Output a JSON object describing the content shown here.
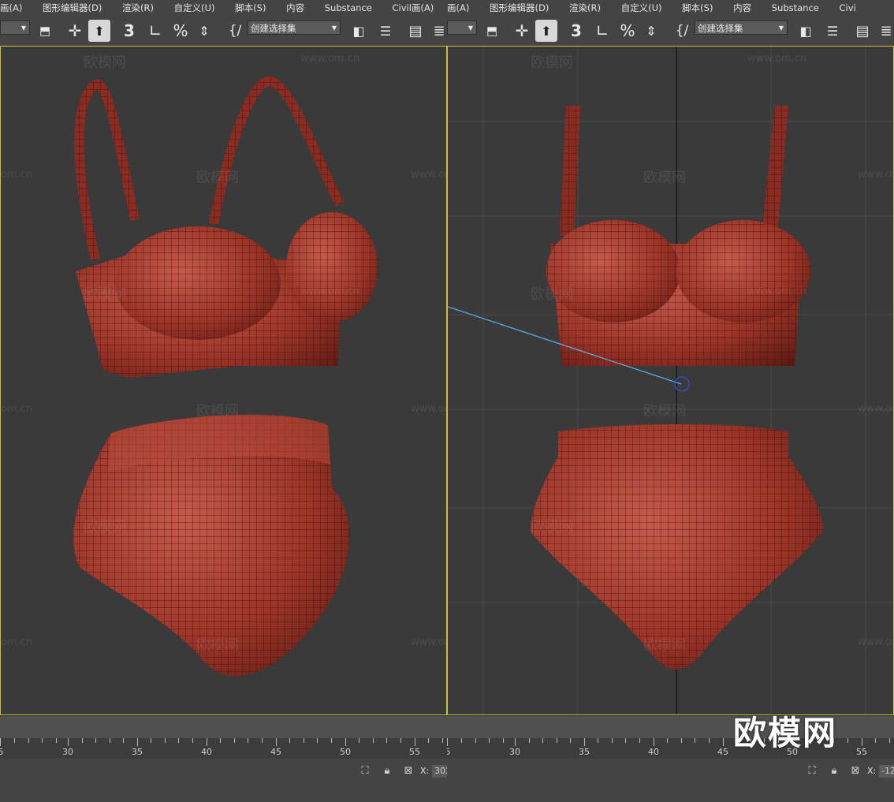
{
  "menu": [
    "画(A)",
    "图形编辑器(D)",
    "渲染(R)",
    "自定义(U)",
    "脚本(S)",
    "内容",
    "Substance",
    "Civil画(A)"
  ],
  "menu_right": [
    "画(A)",
    "图形编辑器(D)",
    "渲染(R)",
    "自定义(U)",
    "脚本(S)",
    "内容",
    "Substance",
    "Civi"
  ],
  "toolbar": {
    "selection_set_placeholder": "创建选择集",
    "snap_3_label": "3",
    "percent_snap_label": "%"
  },
  "watermarks": {
    "brand": "欧模网",
    "url": "www.om.cn",
    "url_short": "om.cn"
  },
  "timeline": {
    "ticks_left": [
      "5",
      "30",
      "35",
      "40",
      "45",
      "50",
      "55"
    ],
    "ticks_right": [
      "5",
      "30",
      "35",
      "40",
      "45",
      "50",
      "55"
    ]
  },
  "status": {
    "x_label": "X:",
    "x_value_left": "302",
    "x_value_right": "-12"
  },
  "logo": "欧模网",
  "colors": {
    "viewport_border": "#c9c136",
    "mesh_fill": "#a23a2e",
    "mesh_wire": "#3a0f0a",
    "pivot_line": "#5aaee0"
  }
}
